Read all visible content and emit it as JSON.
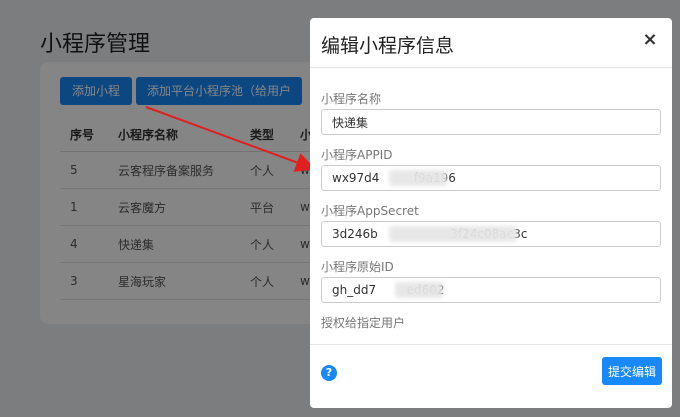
{
  "page": {
    "title": "小程序管理",
    "add_button": "添加小程序",
    "pool_button": "添加平台小程序池（给用户用）",
    "table": {
      "headers": [
        "序号",
        "小程序名称",
        "类型",
        "小"
      ],
      "rows": [
        {
          "no": "5",
          "name": "云客程序备案服务",
          "type": "个人",
          "appid": "w:"
        },
        {
          "no": "1",
          "name": "云客魔方",
          "type": "平台",
          "appid": "w:"
        },
        {
          "no": "4",
          "name": "快递集",
          "type": "个人",
          "appid": "w:"
        },
        {
          "no": "3",
          "name": "星海玩家",
          "type": "个人",
          "appid": "w:"
        }
      ]
    }
  },
  "modal": {
    "title": "编辑小程序信息",
    "close_label": "×",
    "fields": [
      {
        "label": "小程序名称",
        "value": "快递集"
      },
      {
        "label": "小程序APPID",
        "value": "wx97d4         f9a196"
      },
      {
        "label": "小程序AppSecret",
        "value": "3d246b                   3f24c08ac3c"
      },
      {
        "label": "小程序原始ID",
        "value": "gh_dd7        ed602"
      }
    ],
    "authorize_label": "授权给指定用户",
    "help_label": "?",
    "submit_label": "提交编辑"
  },
  "colors": {
    "primary": "#1989fa",
    "annotation_arrow": "#e02020"
  }
}
